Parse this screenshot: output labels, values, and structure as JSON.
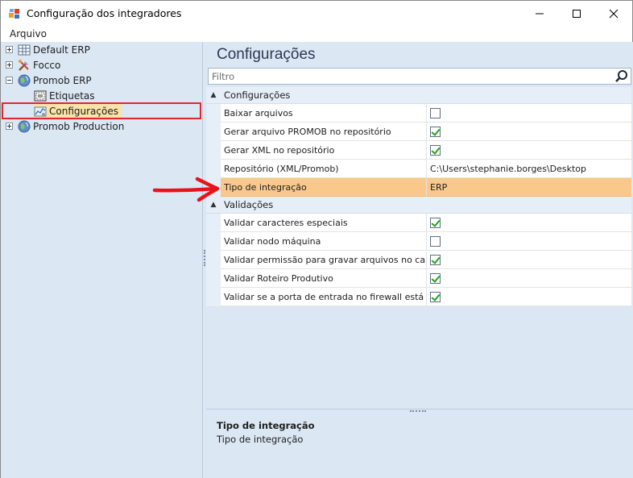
{
  "window": {
    "title": "Configuração dos integradores",
    "minimize_icon": "minimize-icon",
    "maximize_icon": "maximize-icon",
    "close_icon": "close-icon"
  },
  "menu": {
    "arquivo": "Arquivo"
  },
  "tree": {
    "items": [
      {
        "label": "Default ERP",
        "icon": "erp-grid-icon",
        "expander": "plus"
      },
      {
        "label": "Focco",
        "icon": "tools-icon",
        "expander": "plus"
      },
      {
        "label": "Promob ERP",
        "icon": "globe-icon",
        "expander": "minus"
      },
      {
        "label": "Etiquetas",
        "icon": "label-icon",
        "expander": "none"
      },
      {
        "label": "Configurações",
        "icon": "settings-chart-icon",
        "expander": "none",
        "selected": true
      },
      {
        "label": "Promob Production",
        "icon": "globe-icon",
        "expander": "plus"
      }
    ]
  },
  "panel": {
    "title": "Configurações",
    "filter_placeholder": "Filtro",
    "categories": [
      {
        "label": "Configurações",
        "rows": [
          {
            "name": "Baixar arquivos",
            "type": "checkbox",
            "checked": false
          },
          {
            "name": "Gerar arquivo PROMOB no repositório",
            "type": "checkbox",
            "checked": true
          },
          {
            "name": "Gerar XML no repositório",
            "type": "checkbox",
            "checked": true
          },
          {
            "name": "Repositório (XML/Promob)",
            "type": "text",
            "value": "C:\\Users\\stephanie.borges\\Desktop"
          },
          {
            "name": "Tipo de integração",
            "type": "text",
            "value": "ERP",
            "selected": true
          }
        ]
      },
      {
        "label": "Validações",
        "rows": [
          {
            "name": "Validar caracteres especiais",
            "type": "checkbox",
            "checked": true
          },
          {
            "name": "Validar nodo máquina",
            "type": "checkbox",
            "checked": false
          },
          {
            "name": "Validar permissão para gravar arquivos no cami...",
            "type": "checkbox",
            "checked": true
          },
          {
            "name": "Validar Roteiro Produtivo",
            "type": "checkbox",
            "checked": true
          },
          {
            "name": "Validar se a porta de entrada no firewall está ab...",
            "type": "checkbox",
            "checked": true
          }
        ]
      }
    ],
    "description": {
      "title": "Tipo de integração",
      "text": "Tipo de integração"
    }
  },
  "colors": {
    "selected_row": "#f8c98a",
    "panel_bg": "#dce7f4",
    "highlight_box": "#e3262c",
    "arrow": "#e8121b",
    "check": "#21a121"
  }
}
